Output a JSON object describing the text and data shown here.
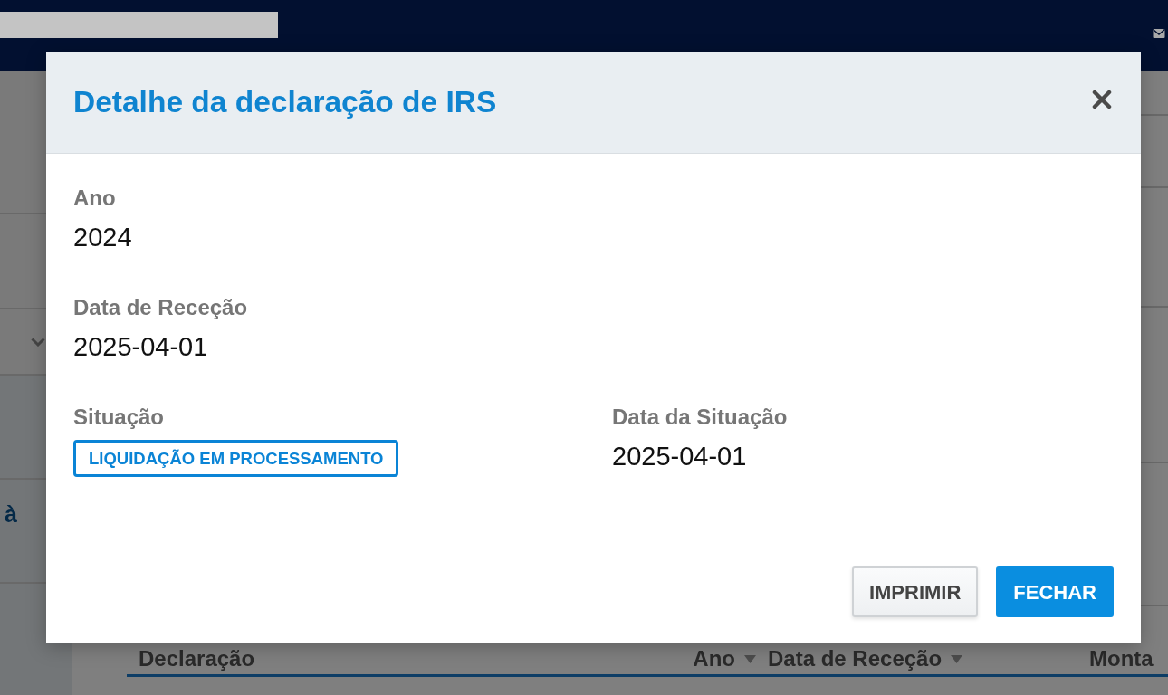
{
  "page": {
    "side_link": "à",
    "table_columns": [
      {
        "label": "Declaração",
        "sortable": false
      },
      {
        "label": "Ano",
        "sortable": true
      },
      {
        "label": "Data de Receção",
        "sortable": true
      },
      {
        "label": "Monta",
        "sortable": false
      }
    ]
  },
  "dialog": {
    "title": "Detalhe da declaração de IRS",
    "rows": [
      [
        {
          "label": "Ano",
          "value": "2024",
          "kind": "text"
        }
      ],
      [
        {
          "label": "Data de Receção",
          "value": "2025-04-01",
          "kind": "text"
        }
      ],
      [
        {
          "label": "Situação",
          "value": "LIQUIDAÇÃO EM PROCESSAMENTO",
          "kind": "badge"
        },
        {
          "label": "Data da Situação",
          "value": "2025-04-01",
          "kind": "text"
        }
      ]
    ],
    "buttons": [
      {
        "label": "IMPRIMIR",
        "kind": "secondary"
      },
      {
        "label": "FECHAR",
        "kind": "primary"
      }
    ]
  }
}
